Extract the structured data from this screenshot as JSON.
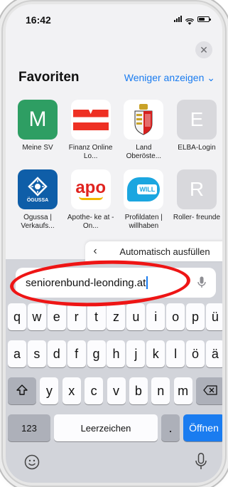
{
  "status_bar": {
    "time": "16:42"
  },
  "favorites": {
    "title": "Favoriten",
    "toggle_label": "Weniger anzeigen",
    "items": [
      {
        "label": "Meine SV",
        "icon": "letter-m-icon",
        "icon_text": "M",
        "color": "#2e9e63"
      },
      {
        "label": "Finanz Online Lo...",
        "icon": "finanz-online-icon",
        "color": "#ee3124"
      },
      {
        "label": "Land Oberöste...",
        "icon": "coat-of-arms-icon",
        "color": "#d6201e"
      },
      {
        "label": "ELBA-Login",
        "icon": "letter-e-icon",
        "icon_text": "E",
        "color": "#d8d8dc"
      },
      {
        "label": "Ögussa | Verkaufs...",
        "icon": "ogussa-icon",
        "icon_text": "ÖGUSSA",
        "color": "#0f5ea8"
      },
      {
        "label": "Apothe- ke at - On...",
        "icon": "apo-icon",
        "icon_text": "apo",
        "color": "#e0231f"
      },
      {
        "label": "Profildaten | willhaben",
        "icon": "willhaben-icon",
        "icon_text": "WILL",
        "color": "#1ba6e0"
      },
      {
        "label": "Roller- freunde",
        "icon": "letter-r-icon",
        "icon_text": "R",
        "color": "#d8d8dc"
      }
    ]
  },
  "autofill": {
    "label": "Automatisch ausfüllen"
  },
  "url_bar": {
    "value": "seniorenbund-leonding.at"
  },
  "keyboard": {
    "row1": [
      "q",
      "w",
      "e",
      "r",
      "t",
      "z",
      "u",
      "i",
      "o",
      "p",
      "ü"
    ],
    "row2": [
      "a",
      "s",
      "d",
      "f",
      "g",
      "h",
      "j",
      "k",
      "l",
      "ö",
      "ä"
    ],
    "row3": [
      "y",
      "x",
      "c",
      "v",
      "b",
      "n",
      "m"
    ],
    "numbers_key": "123",
    "space_key": "Leerzeichen",
    "period_key": ".",
    "go_key": "Öffnen"
  },
  "colors": {
    "accent": "#1a7cf0",
    "highlight": "#ee1515"
  }
}
